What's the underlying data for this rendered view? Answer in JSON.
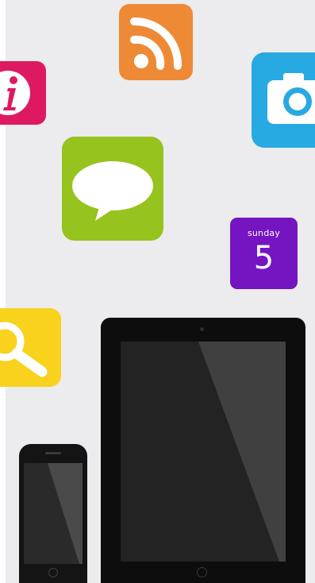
{
  "icons": {
    "rss": "rss-icon",
    "info": "info-icon",
    "camera": "camera-icon",
    "chat": "chat-bubble-icon",
    "calendar": "calendar-icon",
    "search": "search-icon"
  },
  "calendar": {
    "day": "sunday",
    "date": "5"
  },
  "colors": {
    "background": "#ecebed",
    "rss": "#ee8a35",
    "info": "#dd1a61",
    "camera": "#27a9e1",
    "chat": "#96c31e",
    "calendar": "#7515c2",
    "search": "#f8d21c",
    "device": "#0d0d0d"
  }
}
